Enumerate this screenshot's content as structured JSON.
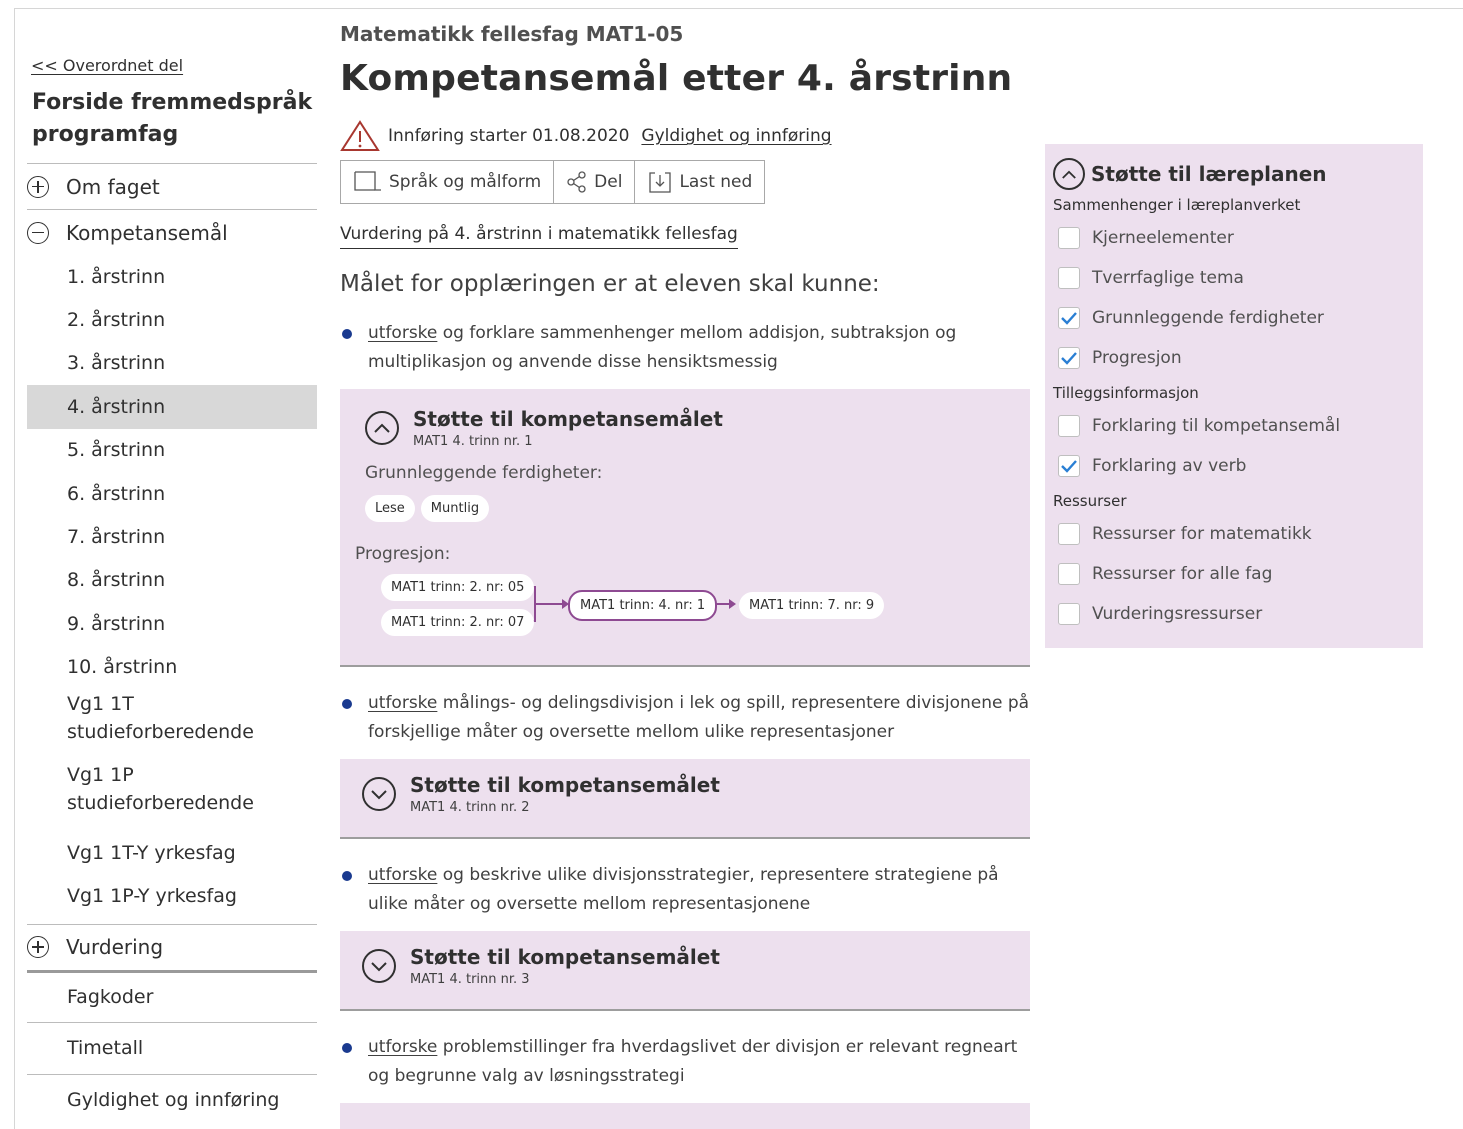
{
  "sidebar": {
    "back_link": "<< Overordnet del",
    "title": "Forside fremmedspråk programfag",
    "sections": {
      "om_faget": "Om faget",
      "kompetansemal": "Kompetansemål",
      "vurdering": "Vurdering"
    },
    "items": [
      {
        "label": "1. årstrinn"
      },
      {
        "label": "2. årstrinn"
      },
      {
        "label": "3. årstrinn"
      },
      {
        "label": "4. årstrinn"
      },
      {
        "label": "5. årstrinn"
      },
      {
        "label": "6. årstrinn"
      },
      {
        "label": "7. årstrinn"
      },
      {
        "label": "8. årstrinn"
      },
      {
        "label": "9. årstrinn"
      },
      {
        "label": "10. årstrinn"
      },
      {
        "label": "Vg1 1T studieforberedende"
      },
      {
        "label": "Vg1 1P studieforberedende"
      },
      {
        "label": "Vg1 1T-Y yrkesfag"
      },
      {
        "label": "Vg1 1P-Y yrkesfag"
      }
    ],
    "active_item": "4. årstrinn",
    "bottom": [
      "Fagkoder",
      "Timetall",
      "Gyldighet og innføring"
    ]
  },
  "main": {
    "subject": "Matematikk fellesfag MAT1-05",
    "title": "Kompetansemål etter 4. årstrinn",
    "intro_text": "Innføring starter 01.08.2020",
    "intro_link": "Gyldighet og innføring",
    "toolbar": {
      "language": "Språk og målform",
      "share": "Del",
      "download": "Last ned"
    },
    "assessment_link": "Vurdering på 4. årstrinn i matematikk fellesfag",
    "lead": "Målet for opplæringen er at eleven skal kunne:",
    "goals": [
      {
        "verb": "utforske",
        "text": " og forklare sammenhenger mellom addisjon, subtraksjon og multiplikasjon og anvende disse hensiktsmessig"
      },
      {
        "verb": "utforske",
        "text": " målings- og delingsdivisjon i lek og spill, representere divisjonene på forskjellige måter og oversette mellom ulike representasjoner"
      },
      {
        "verb": "utforske",
        "text": " og beskrive ulike divisjonsstrategier, representere strategiene på ulike måter og oversette mellom representasjonene"
      },
      {
        "verb": "utforske",
        "text": " problemstillinger fra hverdagslivet der divisjon er relevant regneart og begrunne valg av løsningsstrategi"
      }
    ],
    "support": [
      {
        "title": "Støtte til kompetansemålet",
        "code": "MAT1 4. trinn nr. 1"
      },
      {
        "title": "Støtte til kompetansemålet",
        "code": "MAT1 4. trinn nr. 2"
      },
      {
        "title": "Støtte til kompetansemålet",
        "code": "MAT1 4. trinn nr. 3"
      }
    ],
    "basic_skills_label": "Grunnleggende ferdigheter:",
    "basic_skills": [
      "Lese",
      "Muntlig"
    ],
    "progression_label": "Progresjon:",
    "progression": {
      "prev": [
        "MAT1 trinn: 2. nr: 05",
        "MAT1 trinn: 2. nr: 07"
      ],
      "current": "MAT1 trinn: 4. nr: 1",
      "next": "MAT1 trinn: 7. nr: 9"
    }
  },
  "panel": {
    "title": "Støtte til læreplanen",
    "groups": [
      {
        "label": "Sammenhenger i læreplanverket",
        "items": [
          {
            "label": "Kjerneelementer",
            "checked": false
          },
          {
            "label": "Tverrfaglige tema",
            "checked": false
          },
          {
            "label": "Grunnleggende ferdigheter",
            "checked": true
          },
          {
            "label": "Progresjon",
            "checked": true
          }
        ]
      },
      {
        "label": "Tilleggsinformasjon",
        "items": [
          {
            "label": "Forklaring til kompetansemål",
            "checked": false
          },
          {
            "label": "Forklaring av verb",
            "checked": true
          }
        ]
      },
      {
        "label": "Ressurser",
        "items": [
          {
            "label": "Ressurser for matematikk",
            "checked": false
          },
          {
            "label": "Ressurser for alle fag",
            "checked": false
          },
          {
            "label": "Vurderingsressurser",
            "checked": false
          }
        ]
      }
    ]
  },
  "colors": {
    "support_bg": "#ede0ee",
    "progression_accent": "#8e4a92",
    "bullet": "#1a3a8f",
    "check": "#2a7fd4"
  }
}
